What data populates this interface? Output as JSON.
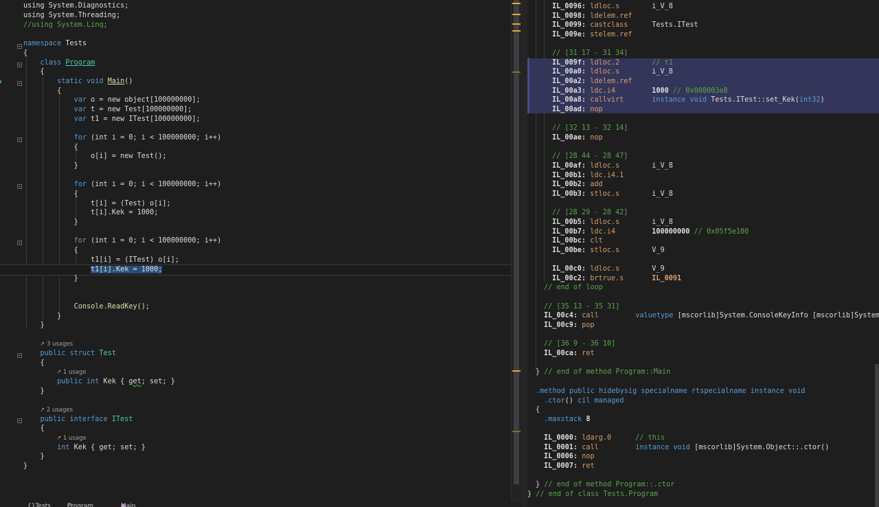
{
  "editor": {
    "lines": {
      "using_diag": "using System.Diagnostics;",
      "using_thread": "using System.Threading;",
      "using_linq": "//using System.Linq;",
      "ns_kw": "namespace",
      "ns_name": "Tests",
      "class_kw": "class",
      "class_name": "Program",
      "main_sig_kw": "static void",
      "main_name": "Main",
      "main_parens": "()",
      "var_o": "new object[100000000];",
      "var_t": "new Test[100000000];",
      "var_t1": "new ITest[100000000];",
      "for_header": "(int i = 0; i < 100000000; i++)",
      "assign_o": "o[i] = new Test();",
      "assign_t": "t[i] = (Test) o[i];",
      "assign_tkek": "t[i].Kek = 1000;",
      "assign_t1": "t1[i] = (ITest) o[i];",
      "assign_t1kek": "t1[i].Kek = 1000;",
      "readkey": "Console.ReadKey();",
      "usages_test": "3 usages",
      "struct_decl": "public struct Test",
      "usage_kek": "1 usage",
      "prop_kek": "public int Kek { get; set; }",
      "usages_itest": "2 usages",
      "iface_decl": "public interface ITest",
      "iface_prop": "int Kek { get; set; }"
    }
  },
  "il_view": {
    "highlight_color": "#34355a",
    "lines": [
      [
        "IL_0096:",
        "ldloc.s",
        "i_V_8",
        ""
      ],
      [
        "IL_0098:",
        "ldelem.ref",
        "",
        ""
      ],
      [
        "IL_0099:",
        "castclass",
        "Tests.ITest",
        ""
      ],
      [
        "IL_009e:",
        "stelem.ref",
        "",
        ""
      ],
      [
        "",
        "",
        "",
        "// [31 17 - 31 34]"
      ],
      [
        "IL_009f:",
        "ldloc.2",
        "// t1",
        ""
      ],
      [
        "IL_00a0:",
        "ldloc.s",
        "i_V_8",
        ""
      ],
      [
        "IL_00a2:",
        "ldelem.ref",
        "",
        ""
      ],
      [
        "IL_00a3:",
        "ldc.i4",
        "1000 // 0x000003e8",
        ""
      ],
      [
        "IL_00a8:",
        "callvirt",
        "instance void Tests.ITest::set_Kek(int32)",
        ""
      ],
      [
        "IL_00ad:",
        "nop",
        "",
        ""
      ],
      [
        "",
        "",
        "",
        "// [32 13 - 32 14]"
      ],
      [
        "IL_00ae:",
        "nop",
        "",
        ""
      ],
      [
        "",
        "",
        "",
        "// [28 44 - 28 47]"
      ],
      [
        "IL_00af:",
        "ldloc.s",
        "i_V_8",
        ""
      ],
      [
        "IL_00b1:",
        "ldc.i4.1",
        "",
        ""
      ],
      [
        "IL_00b2:",
        "add",
        "",
        ""
      ],
      [
        "IL_00b3:",
        "stloc.s",
        "i_V_8",
        ""
      ],
      [
        "",
        "",
        "",
        "// [28 29 - 28 42]"
      ],
      [
        "IL_00b5:",
        "ldloc.s",
        "i_V_8",
        ""
      ],
      [
        "IL_00b7:",
        "ldc.i4",
        "100000000 // 0x05f5e100",
        ""
      ],
      [
        "IL_00bc:",
        "clt",
        "",
        ""
      ],
      [
        "IL_00be:",
        "stloc.s",
        "V_9",
        ""
      ],
      [
        "IL_00c0:",
        "ldloc.s",
        "V_9",
        ""
      ],
      [
        "IL_00c2:",
        "brtrue.s",
        "IL_0091",
        ""
      ],
      [
        "",
        "",
        "",
        "// end of loop"
      ],
      [
        "",
        "",
        "",
        "// [35 13 - 35 31]"
      ],
      [
        "IL_00c4:",
        "call",
        "valuetype [mscorlib]System.ConsoleKeyInfo [mscorlib]System.C",
        ""
      ],
      [
        "IL_00c9:",
        "pop",
        "",
        ""
      ],
      [
        "",
        "",
        "",
        "// [36 9 - 36 10]"
      ],
      [
        "IL_00ca:",
        "ret",
        "",
        ""
      ],
      [
        "",
        "",
        "",
        "} // end of method Program::Main"
      ],
      [
        "",
        "",
        "",
        ".method public hidebysig specialname rtspecialname instance void"
      ],
      [
        "",
        "",
        "",
        ".ctor() cil managed"
      ],
      [
        "",
        "",
        "",
        "{"
      ],
      [
        "",
        "",
        "",
        ".maxstack 8"
      ],
      [
        "IL_0000:",
        "ldarg.0",
        "// this",
        ""
      ],
      [
        "IL_0001:",
        "call",
        "instance void [mscorlib]System.Object::.ctor()",
        ""
      ],
      [
        "IL_0006:",
        "nop",
        "",
        ""
      ],
      [
        "IL_0007:",
        "ret",
        "",
        ""
      ],
      [
        "",
        "",
        "",
        "} // end of method Program::.ctor"
      ],
      [
        "",
        "",
        "",
        "} // end of class Tests.Program"
      ]
    ]
  },
  "bottom_tabs": [
    "Tests",
    "Program",
    "Main"
  ]
}
